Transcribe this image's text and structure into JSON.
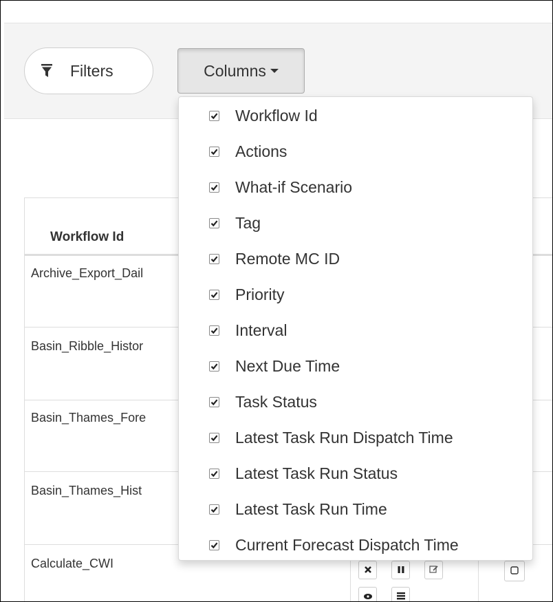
{
  "toolbar": {
    "filters_label": "Filters",
    "columns_label": "Columns"
  },
  "table": {
    "header": "Workflow Id",
    "rows": [
      "Archive_Export_Dail",
      "Basin_Ribble_Histor",
      "Basin_Thames_Fore",
      "Basin_Thames_Hist",
      "Calculate_CWI"
    ]
  },
  "columns_menu": {
    "items": [
      {
        "label": "Workflow Id",
        "checked": true
      },
      {
        "label": "Actions",
        "checked": true
      },
      {
        "label": "What-if Scenario",
        "checked": true
      },
      {
        "label": "Tag",
        "checked": true
      },
      {
        "label": "Remote MC ID",
        "checked": true
      },
      {
        "label": "Priority",
        "checked": true
      },
      {
        "label": "Interval",
        "checked": true
      },
      {
        "label": "Next Due Time",
        "checked": true
      },
      {
        "label": "Task Status",
        "checked": true
      },
      {
        "label": "Latest Task Run Dispatch Time",
        "checked": true
      },
      {
        "label": "Latest Task Run Status",
        "checked": true
      },
      {
        "label": "Latest Task Run Time",
        "checked": true
      },
      {
        "label": "Current Forecast Dispatch Time",
        "checked": true
      }
    ]
  },
  "icons": {
    "filter": "filter-icon",
    "delete": "close-icon",
    "pause": "pause-icon",
    "edit": "edit-icon",
    "view": "eye-icon",
    "list": "list-icon",
    "select": "checkbox-icon"
  }
}
